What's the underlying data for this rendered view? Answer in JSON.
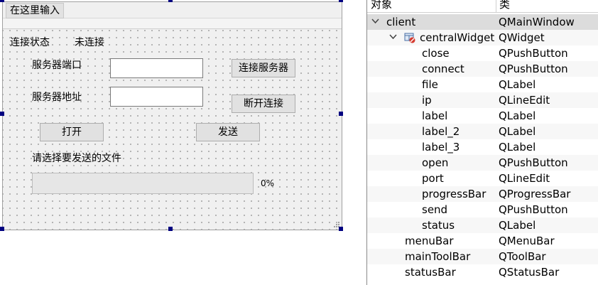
{
  "form": {
    "menubar": {
      "placeholder": "在这里输入"
    },
    "status_label": "连接状态",
    "status_value": "未连接",
    "port_label": "服务器端口",
    "ip_label": "服务器地址",
    "connect_button": "连接服务器",
    "close_button": "断开连接",
    "open_button": "打开",
    "send_button": "发送",
    "file_label": "请选择要发送的文件",
    "progress": {
      "value": 0,
      "text": "0%"
    },
    "colors": {
      "progress_chunk": "#06b025",
      "handle": "#000080",
      "form_bg": "#f0f0f0"
    }
  },
  "inspector": {
    "header": {
      "object": "对象",
      "class": "类"
    },
    "rows": [
      {
        "object": "client",
        "class": "QMainWindow"
      },
      {
        "object": "centralWidget",
        "class": "QWidget"
      },
      {
        "object": "close",
        "class": "QPushButton"
      },
      {
        "object": "connect",
        "class": "QPushButton"
      },
      {
        "object": "file",
        "class": "QLabel"
      },
      {
        "object": "ip",
        "class": "QLineEdit"
      },
      {
        "object": "label",
        "class": "QLabel"
      },
      {
        "object": "label_2",
        "class": "QLabel"
      },
      {
        "object": "label_3",
        "class": "QLabel"
      },
      {
        "object": "open",
        "class": "QPushButton"
      },
      {
        "object": "port",
        "class": "QLineEdit"
      },
      {
        "object": "progressBar",
        "class": "QProgressBar"
      },
      {
        "object": "send",
        "class": "QPushButton"
      },
      {
        "object": "status",
        "class": "QLabel"
      },
      {
        "object": "menuBar",
        "class": "QMenuBar"
      },
      {
        "object": "mainToolBar",
        "class": "QToolBar"
      },
      {
        "object": "statusBar",
        "class": "QStatusBar"
      }
    ],
    "icons": {
      "expand": "chevron-down-icon",
      "layout": "broken-layout-icon"
    }
  }
}
